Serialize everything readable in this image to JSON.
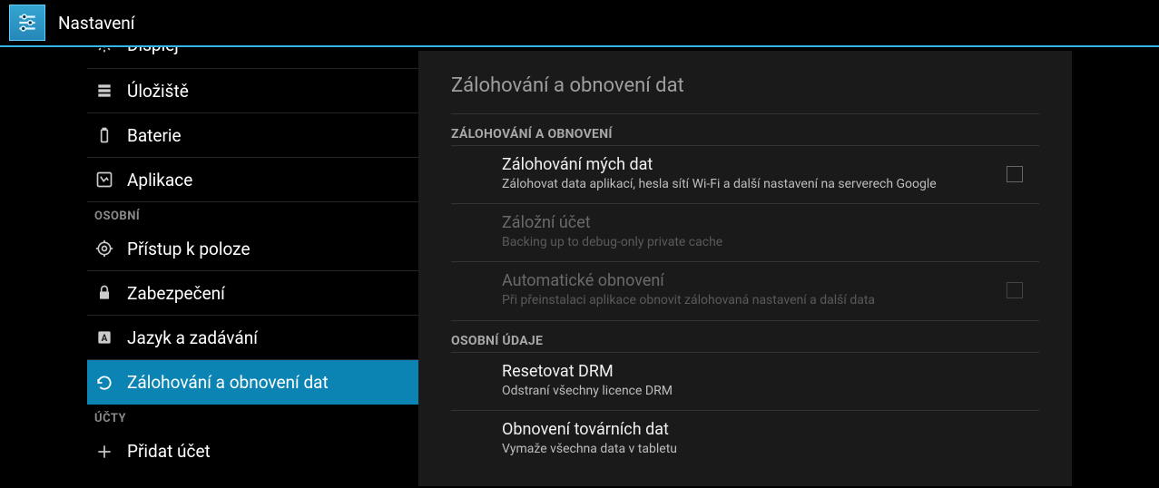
{
  "titlebar": {
    "title": "Nastavení"
  },
  "sidebar": {
    "items": [
      {
        "label": "Displej",
        "icon": "display-icon"
      },
      {
        "label": "Úložiště",
        "icon": "storage-icon"
      },
      {
        "label": "Baterie",
        "icon": "battery-icon"
      },
      {
        "label": "Aplikace",
        "icon": "apps-icon"
      }
    ],
    "header_personal": "OSOBNÍ",
    "personal": [
      {
        "label": "Přístup k poloze",
        "icon": "location-icon"
      },
      {
        "label": "Zabezpečení",
        "icon": "lock-icon"
      },
      {
        "label": "Jazyk a zadávání",
        "icon": "language-icon"
      },
      {
        "label": "Zálohování a obnovení dat",
        "icon": "restore-icon",
        "selected": true
      }
    ],
    "header_accounts": "ÚČTY",
    "add_account_label": "Přidat účet"
  },
  "main": {
    "title": "Zálohování a obnovení dat",
    "section_backup_restore": "ZÁLOHOVÁNÍ A OBNOVENÍ",
    "backup_my_data": {
      "title": "Zálohování mých dat",
      "summary": "Zálohovat data aplikací, hesla sítí Wi-Fi a další nastavení na serverech Google",
      "checked": false
    },
    "backup_account": {
      "title": "Záložní účet",
      "summary": "Backing up to debug-only private cache"
    },
    "auto_restore": {
      "title": "Automatické obnovení",
      "summary": "Při přeinstalaci aplikace obnovit zálohovaná nastavení a další data",
      "checked": false
    },
    "section_personal_data": "OSOBNÍ ÚDAJE",
    "reset_drm": {
      "title": "Resetovat DRM",
      "summary": "Odstraní všechny licence DRM"
    },
    "factory_reset": {
      "title": "Obnovení továrních dat",
      "summary": "Vymaže všechna data v tabletu"
    }
  }
}
